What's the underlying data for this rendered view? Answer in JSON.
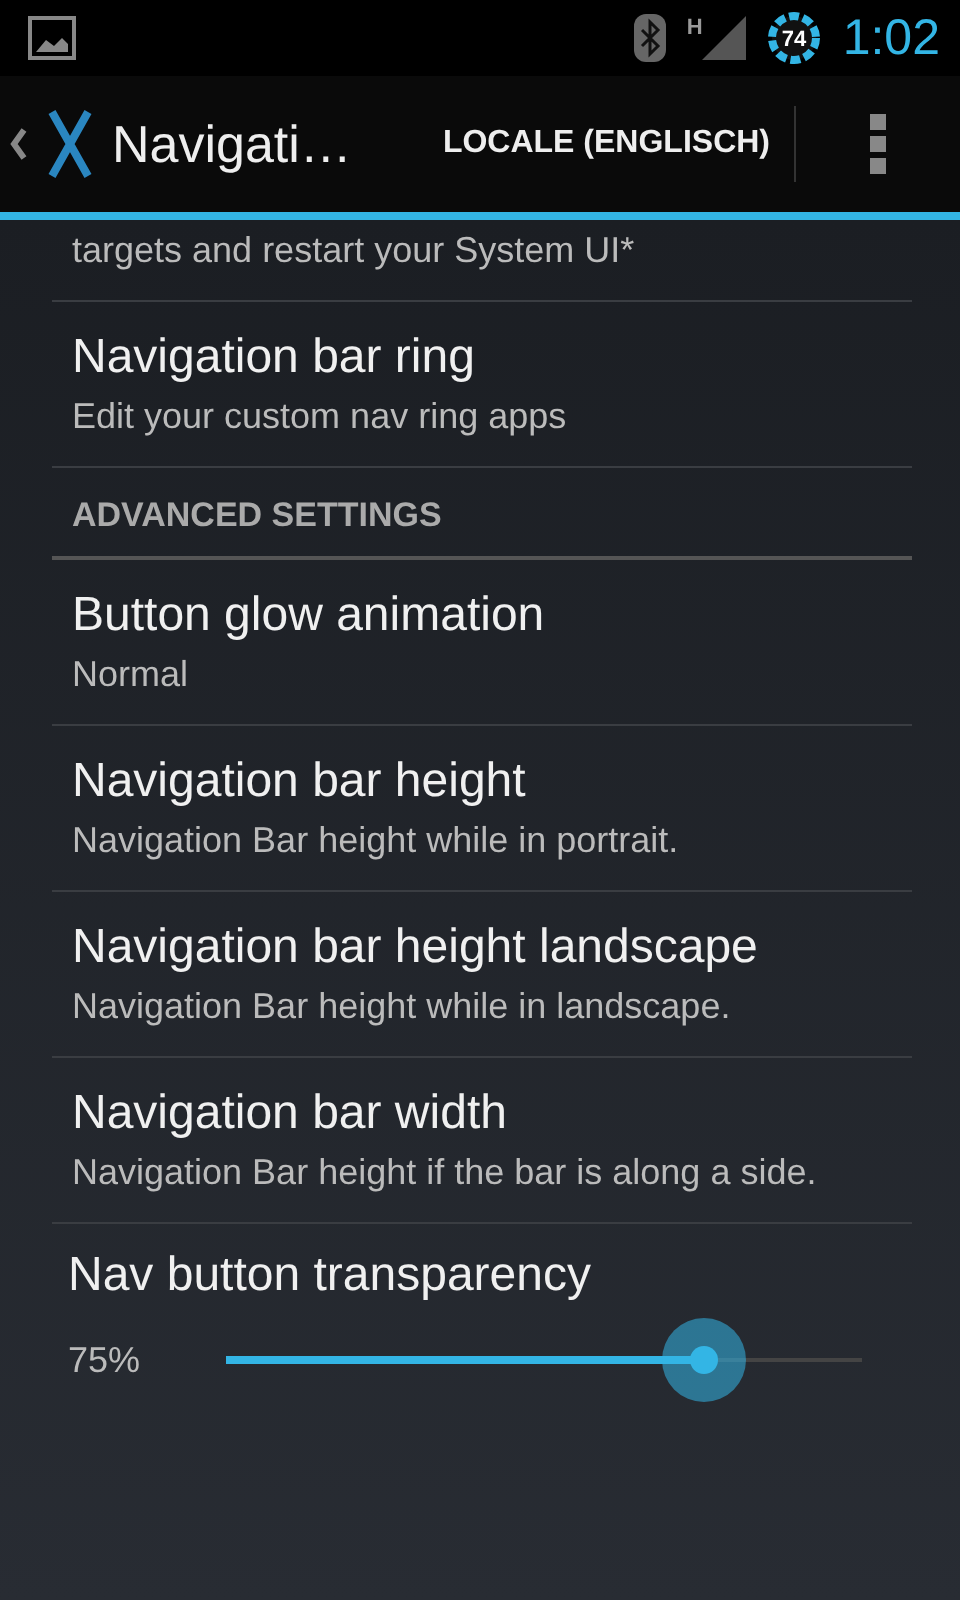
{
  "status_bar": {
    "network": "H",
    "battery": "74",
    "time": "1:02"
  },
  "action_bar": {
    "title": "Navigati…",
    "action": "LOCALE (ENGLISCH)"
  },
  "intro": {
    "summary": "targets and restart your System UI*"
  },
  "items": [
    {
      "kind": "item",
      "title": "Navigation bar ring",
      "summary": "Edit your custom nav ring apps"
    },
    {
      "kind": "header",
      "title": "ADVANCED SETTINGS"
    },
    {
      "kind": "item",
      "title": "Button glow animation",
      "summary": "Normal"
    },
    {
      "kind": "item",
      "title": "Navigation bar height",
      "summary": "Navigation Bar height while in portrait."
    },
    {
      "kind": "item",
      "title": "Navigation bar height landscape",
      "summary": "Navigation Bar height while in landscape."
    },
    {
      "kind": "item",
      "title": "Navigation bar width",
      "summary": "Navigation Bar height if the bar is along a side."
    },
    {
      "kind": "slider",
      "title": "Nav button transparency",
      "reading": "75%",
      "level": 0.75
    }
  ]
}
